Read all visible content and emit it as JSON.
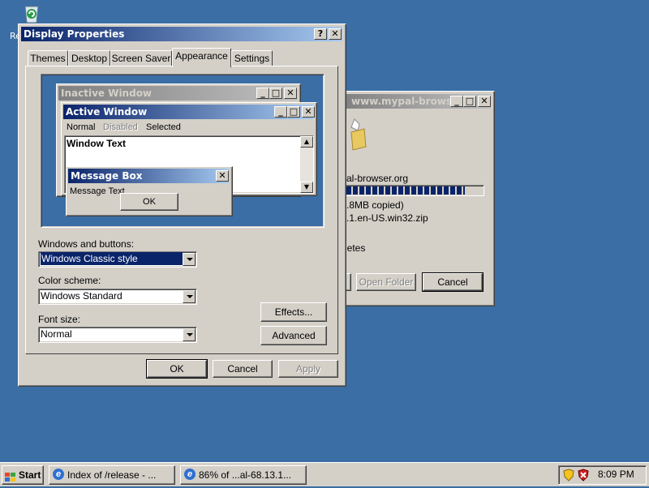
{
  "desktop": {
    "recycle_label": "Re"
  },
  "display_properties": {
    "title": "Display Properties",
    "help_btn": "?",
    "close_btn": "✕",
    "tabs": [
      {
        "label": "Themes"
      },
      {
        "label": "Desktop"
      },
      {
        "label": "Screen Saver"
      },
      {
        "label": "Appearance"
      },
      {
        "label": "Settings"
      }
    ],
    "preview": {
      "inactive_title": "Inactive Window",
      "active_title": "Active Window",
      "menu_normal": "Normal",
      "menu_disabled": "Disabled",
      "menu_selected": "Selected",
      "window_text": "Window Text",
      "msgbox_title": "Message Box",
      "msgbox_text": "Message Text",
      "msgbox_ok": "OK"
    },
    "windows_buttons_label": "Windows and buttons:",
    "windows_buttons_value": "Windows Classic style",
    "color_scheme_label": "Color scheme:",
    "color_scheme_value": "Windows Standard",
    "font_size_label": "Font size:",
    "font_size_value": "Normal",
    "effects_btn": "Effects...",
    "advanced_btn": "Advanced",
    "ok_btn": "OK",
    "cancel_btn": "Cancel",
    "apply_btn": "Apply"
  },
  "download_window": {
    "title": "www.mypal-browser....",
    "from_text": "al-browser.org",
    "progress_text": ".8MB copied)",
    "progress_fraction": 0.86,
    "file_text": ".1.en-US.win32.zip",
    "letes_text": "letes",
    "open_folder_btn": "Open Folder",
    "cancel_btn": "Cancel"
  },
  "taskbar": {
    "start_label": "Start",
    "tasks": [
      {
        "label": "Index of /release - ..."
      },
      {
        "label": "86% of ...al-68.13.1..."
      }
    ],
    "clock": "8:09 PM"
  },
  "colors": {
    "desktop": "#3a6ea5",
    "face": "#d4d0c8",
    "active_title": "#0a246a",
    "inactive_title": "#808080"
  }
}
